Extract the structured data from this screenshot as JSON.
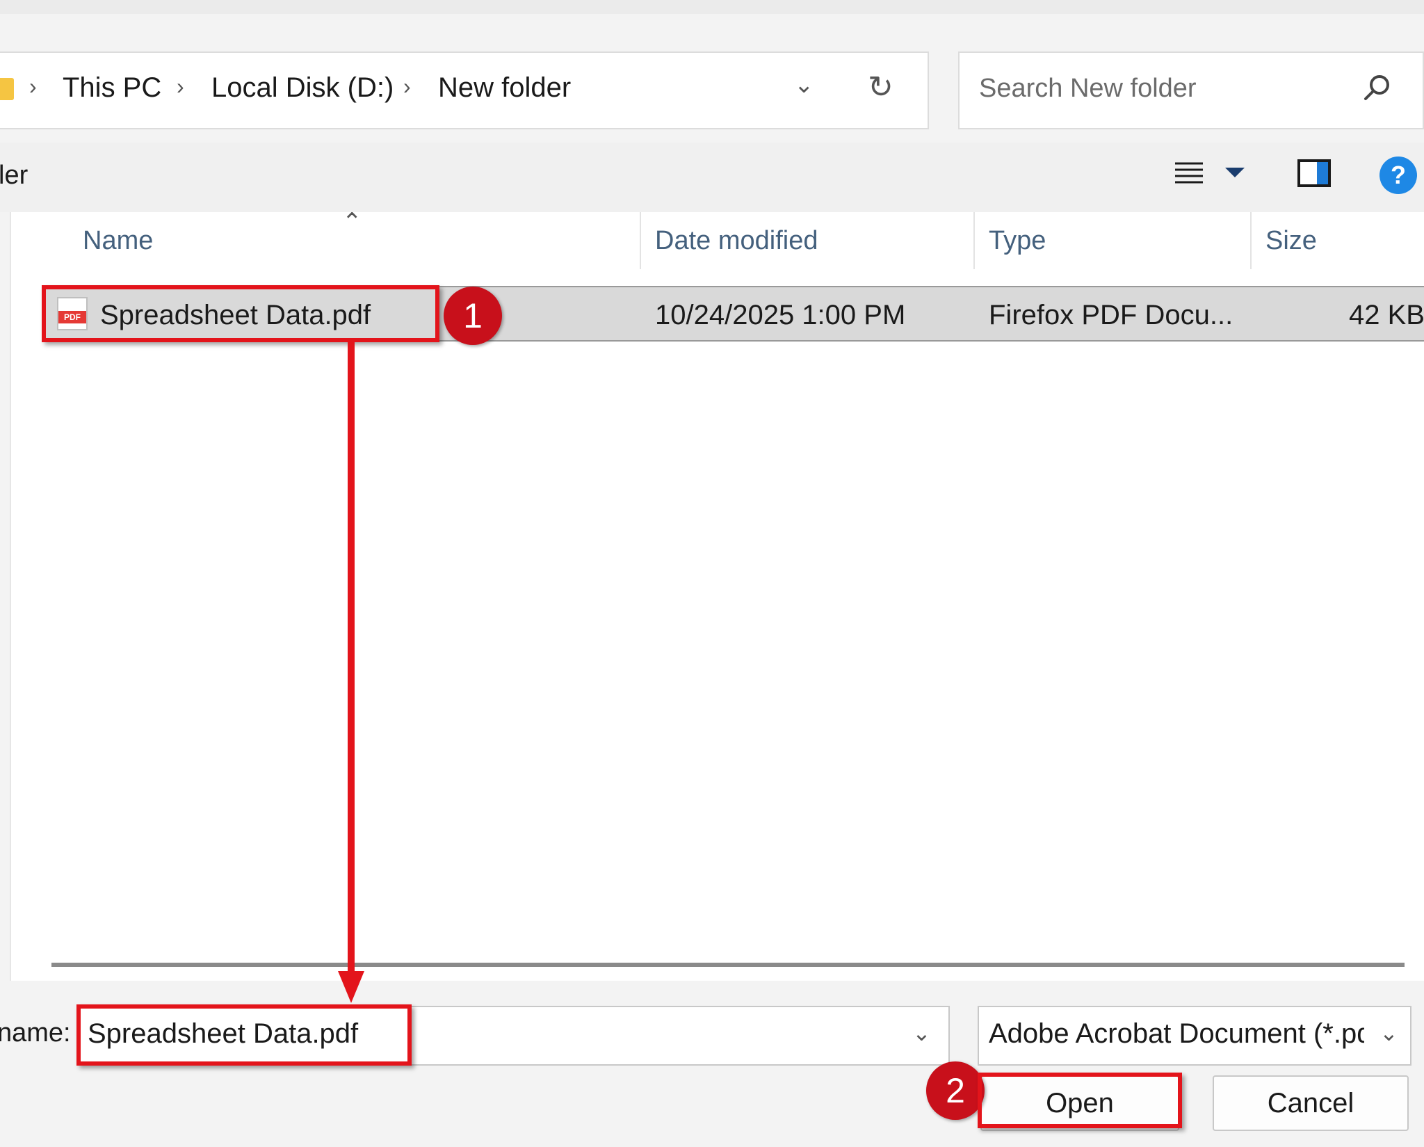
{
  "breadcrumb": {
    "items": [
      "This PC",
      "Local Disk (D:)",
      "New folder"
    ],
    "separator": "›"
  },
  "search": {
    "placeholder": "Search New folder"
  },
  "toolbar": {
    "partial_label": "ler",
    "help_glyph": "?"
  },
  "columns": {
    "name": "Name",
    "date": "Date modified",
    "type": "Type",
    "size": "Size"
  },
  "files": [
    {
      "name": "Spreadsheet Data.pdf",
      "date": "10/24/2025 1:00 PM",
      "type": "Firefox PDF Docu...",
      "size": "42 KB",
      "icon": "pdf-file-icon",
      "icon_tag": "PDF"
    }
  ],
  "file_name": {
    "label": "name:",
    "value": "Spreadsheet Data.pdf"
  },
  "file_type": {
    "value": "Adobe Acrobat Document (*.pdf"
  },
  "buttons": {
    "open": "Open",
    "cancel": "Cancel"
  },
  "annotations": {
    "step1": "1",
    "step2": "2",
    "color": "#e3141b"
  },
  "colors": {
    "selected_row": "#d9d9d9",
    "help_blue": "#1e88e5",
    "pdf_red": "#e53935"
  }
}
